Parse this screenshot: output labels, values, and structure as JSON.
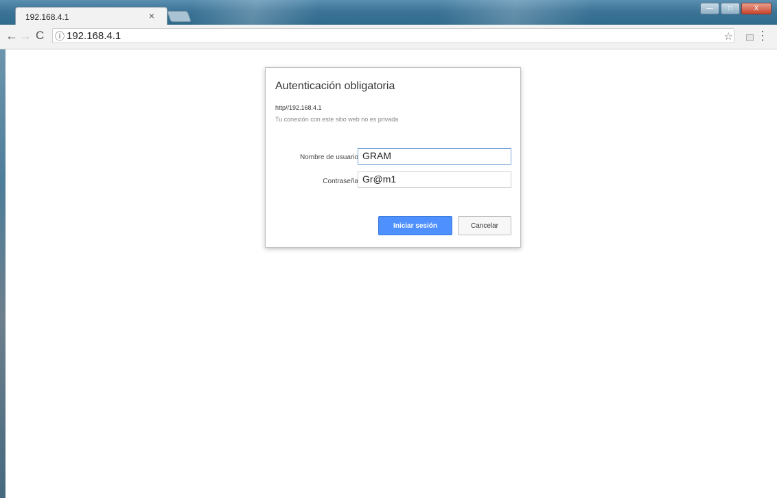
{
  "browser": {
    "tab": {
      "title": "192.168.4.1",
      "close_label": "×"
    },
    "address_bar": {
      "url": "192.168.4.1",
      "info_icon": "ⓘ"
    },
    "nav": {
      "back": "←",
      "forward": "→",
      "reload": "C"
    },
    "toolbar_icons": {
      "star": "☆",
      "menu": "⋮"
    },
    "window_controls": {
      "minimize": "—",
      "maximize": "□",
      "close": "X"
    }
  },
  "auth_dialog": {
    "title": "Autenticación obligatoria",
    "origin": "http//192.168.4.1",
    "warning": "Tu conexión con este sitio web no es privada",
    "username_label": "Nombre de usuario",
    "username_value": "GRAM",
    "password_label": "Contraseña",
    "password_value": "Gr@m1",
    "signin_label": "Iniciar sesión",
    "cancel_label": "Cancelar"
  },
  "colors": {
    "accent_button": "#4d90fe",
    "titlebar": "#3d7497"
  }
}
